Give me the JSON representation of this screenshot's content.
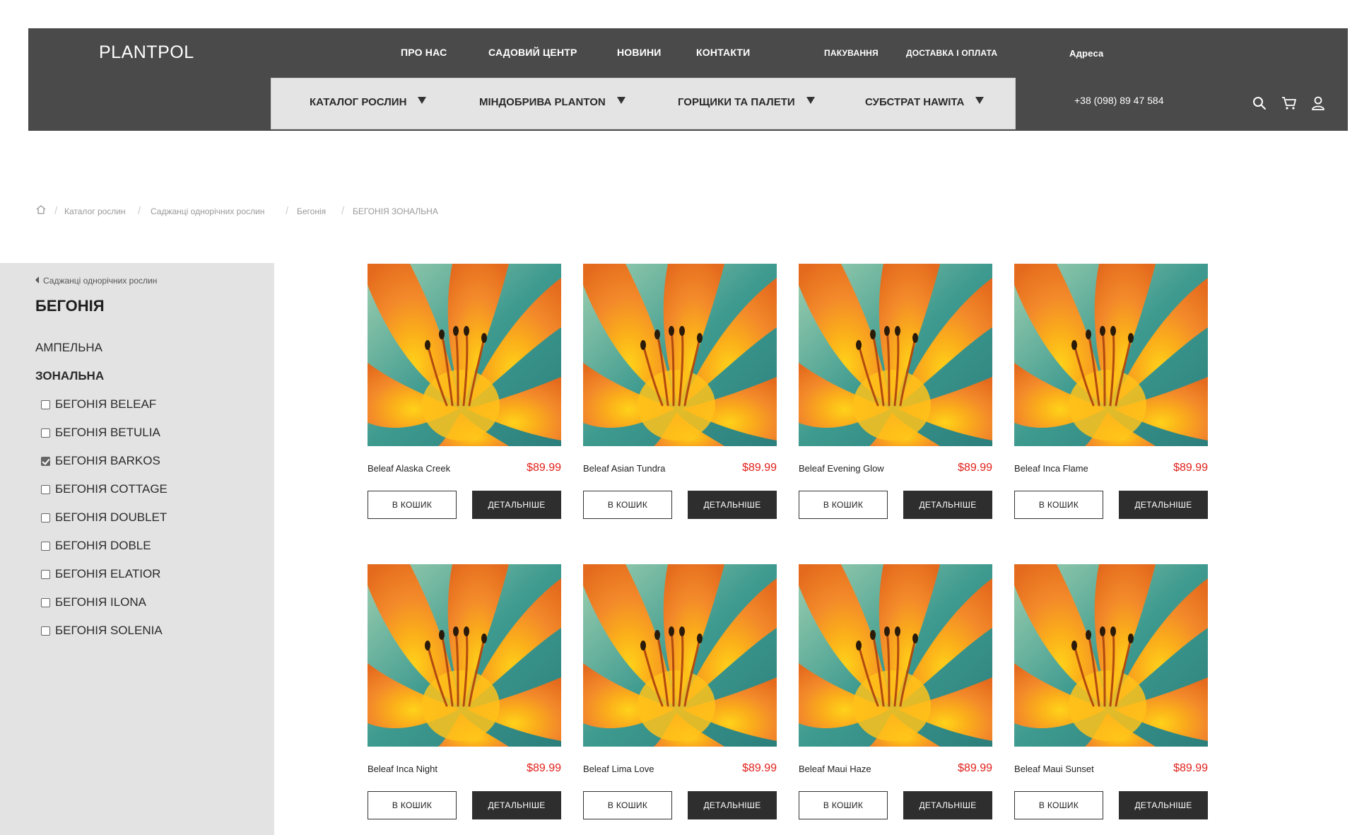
{
  "brand": "PLANTPOL",
  "topnav": {
    "about": "ПРО НАС",
    "garden": "САДОВИЙ ЦЕНТР",
    "news": "НОВИНИ",
    "contacts": "КОНТАКТИ",
    "packaging": "ПАКУВАННЯ",
    "delivery": "ДОСТАВКА І ОПЛАТА",
    "address": "Адреса"
  },
  "phone": "+38 (098) 89 47 584",
  "categories": [
    "КАТАЛОГ РОСЛИН",
    "МІНДОБРИВА PLANTON",
    "ГОРЩИКИ ТА ПАЛЕТИ",
    "СУБСТРАТ HAWITA"
  ],
  "icons": {
    "search": "search-icon",
    "cart": "cart-icon",
    "user": "user-icon",
    "home": "home-icon"
  },
  "breadcrumb": [
    "Каталог рослин",
    "Саджанці однорічних рослин",
    "Бегонія",
    "БЕГОНІЯ ЗОНАЛЬНА"
  ],
  "breadcrumb_sep": "/",
  "sidebar": {
    "back_label": "Саджанці однорічних рослин",
    "title": "БЕГОНІЯ",
    "subcategories": [
      {
        "label": "АМПЕЛЬНА",
        "active": false
      },
      {
        "label": "ЗОНАЛЬНА",
        "active": true
      }
    ],
    "filters": [
      {
        "label": "БЕГОНІЯ BELEAF",
        "checked": false
      },
      {
        "label": "БЕГОНІЯ BETULIA",
        "checked": false
      },
      {
        "label": "БЕГОНІЯ BARKOS",
        "checked": true
      },
      {
        "label": "БЕГОНІЯ COTTAGE",
        "checked": false
      },
      {
        "label": "БЕГОНІЯ DOUBLET",
        "checked": false
      },
      {
        "label": "БЕГОНІЯ DOBLE",
        "checked": false
      },
      {
        "label": "БЕГОНІЯ ELATIOR",
        "checked": false
      },
      {
        "label": "БЕГОНІЯ ILONA",
        "checked": false
      },
      {
        "label": "БЕГОНІЯ SOLENIA",
        "checked": false
      }
    ]
  },
  "buttons": {
    "cart": "В КОШИК",
    "details": "ДЕТАЛЬНІШЕ"
  },
  "products": [
    {
      "name": "Beleaf Alaska Creek",
      "price": "$89.99"
    },
    {
      "name": "Beleaf Asian Tundra",
      "price": "$89.99"
    },
    {
      "name": "Beleaf Evening Glow",
      "price": "$89.99"
    },
    {
      "name": "Beleaf Inca Flame",
      "price": "$89.99"
    },
    {
      "name": "Beleaf Inca Night",
      "price": "$89.99"
    },
    {
      "name": "Beleaf Lima Love",
      "price": "$89.99"
    },
    {
      "name": "Beleaf Maui Haze",
      "price": "$89.99"
    },
    {
      "name": "Beleaf Maui Sunset",
      "price": "$89.99"
    }
  ],
  "colors": {
    "header_bg": "#4a4a4a",
    "category_bar_bg": "#e4e4e4",
    "sidebar_bg": "#e3e3e3",
    "price": "#e0211b",
    "details_button_bg": "#2e2e2e"
  }
}
